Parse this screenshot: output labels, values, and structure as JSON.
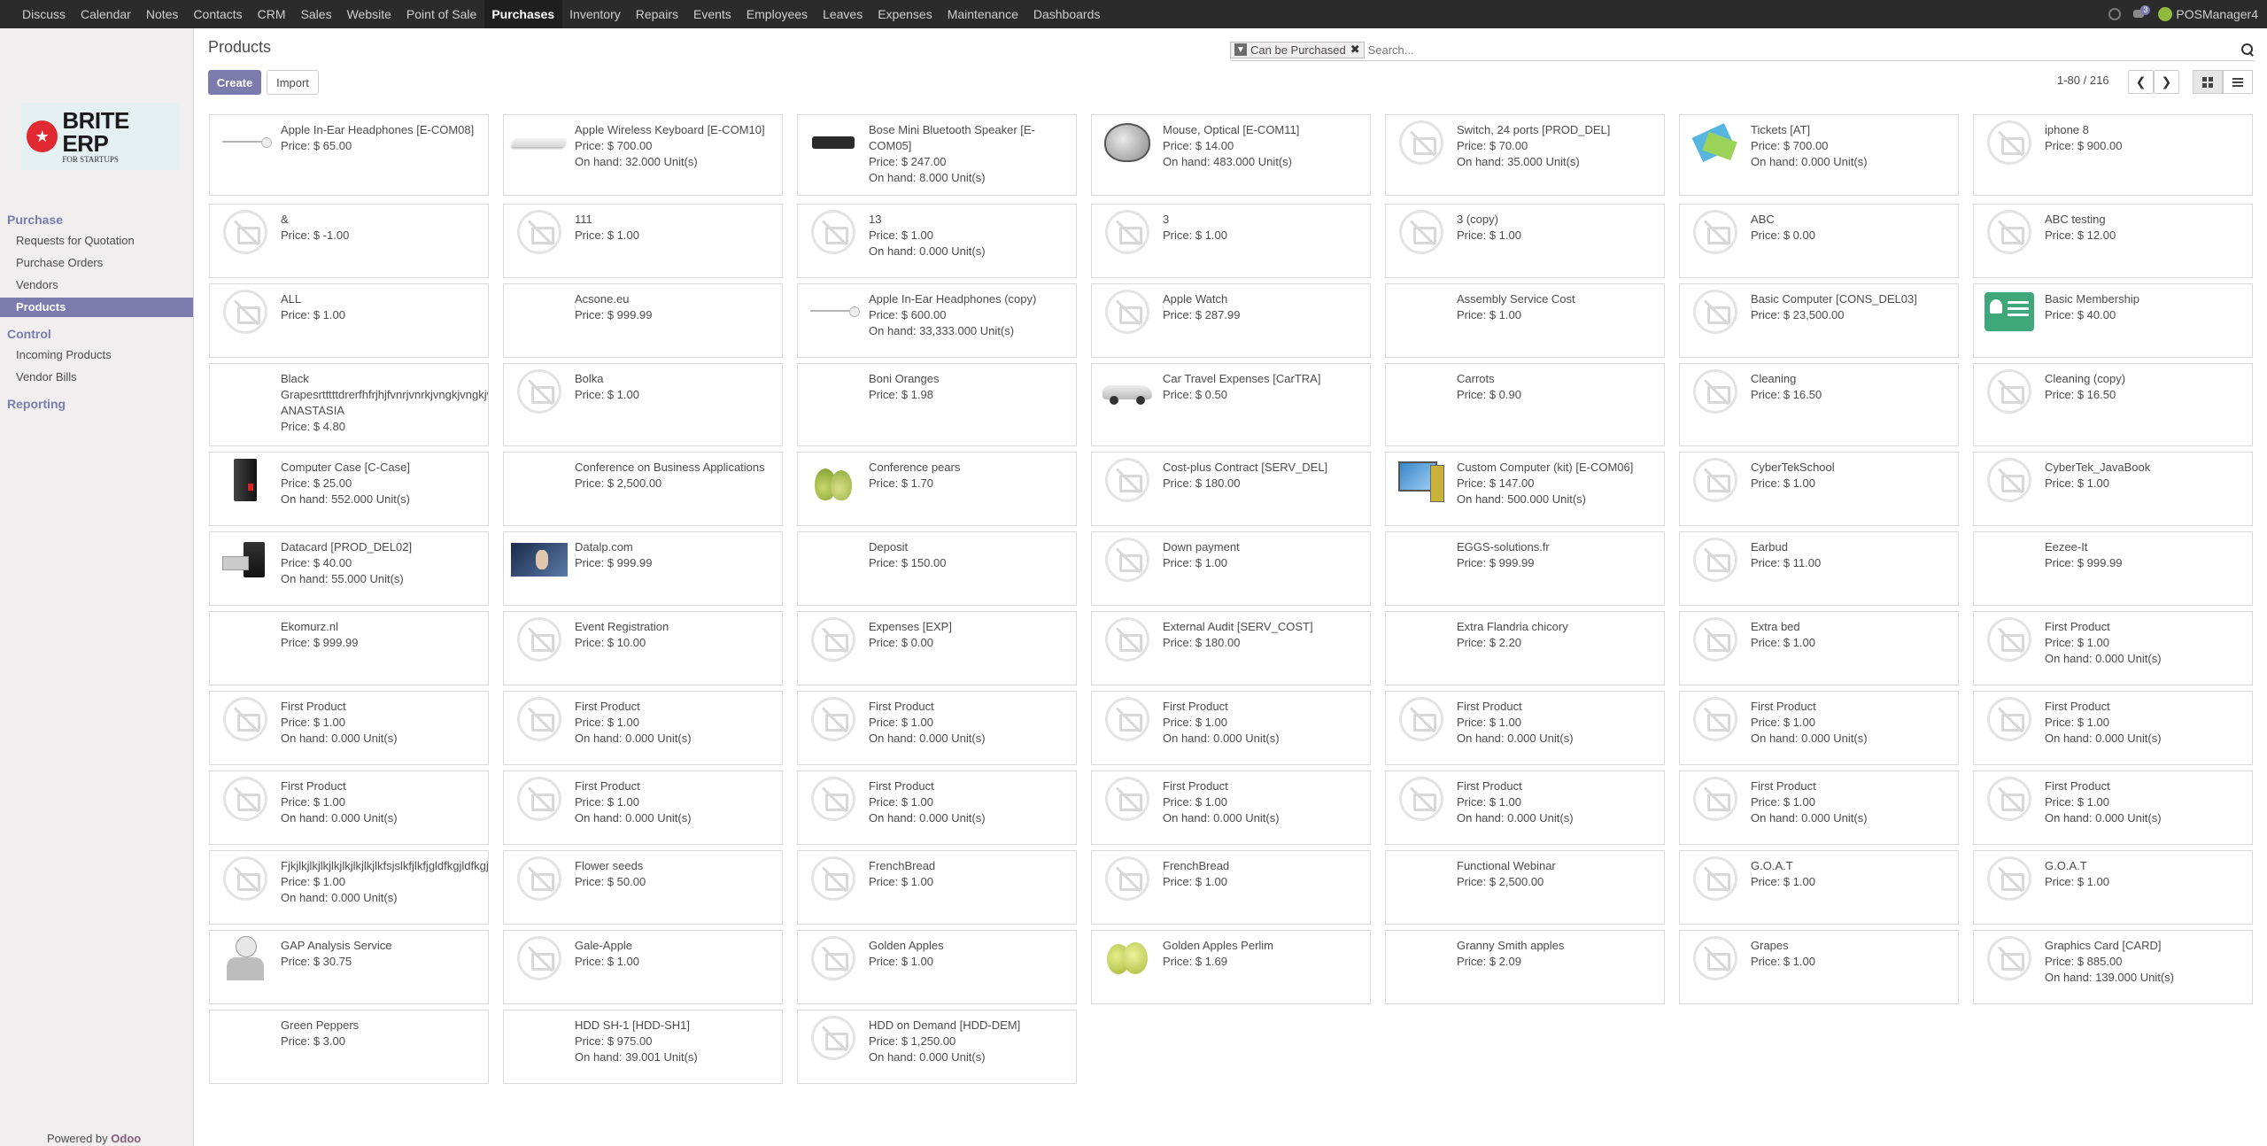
{
  "nav": {
    "apps": [
      "Discuss",
      "Calendar",
      "Notes",
      "Contacts",
      "CRM",
      "Sales",
      "Website",
      "Point of Sale",
      "Purchases",
      "Inventory",
      "Repairs",
      "Events",
      "Employees",
      "Leaves",
      "Expenses",
      "Maintenance",
      "Dashboards"
    ],
    "active": "Purchases",
    "chat_badge": "3",
    "user": "POSManager4"
  },
  "logo": {
    "title": "BRITE ERP",
    "subtitle": "FOR STARTUPS"
  },
  "sidebar": {
    "purchase_header": "Purchase",
    "purchase_items": [
      "Requests for Quotation",
      "Purchase Orders",
      "Vendors",
      "Products"
    ],
    "control_header": "Control",
    "control_items": [
      "Incoming Products",
      "Vendor Bills"
    ],
    "reporting_header": "Reporting",
    "powered_prefix": "Powered by",
    "powered_brand": "Odoo"
  },
  "control_panel": {
    "breadcrumb": "Products",
    "create_label": "Create",
    "import_label": "Import",
    "filter_facet": "Can be Purchased",
    "search_placeholder": "Search...",
    "pager": "1-80 / 216"
  },
  "products": [
    {
      "name": "Apple In-Ear Headphones [E-COM08]",
      "price": "Price: $ 65.00",
      "onhand": "",
      "img": "headphones",
      "wrap": true
    },
    {
      "name": "Apple Wireless Keyboard [E-COM10]",
      "price": "Price: $ 700.00",
      "onhand": "On hand: 32.000 Unit(s)",
      "img": "keyboard"
    },
    {
      "name": "Bose Mini Bluetooth Speaker [E-COM05]",
      "price": "Price: $ 247.00",
      "onhand": "On hand: 8.000 Unit(s)",
      "img": "speaker",
      "wrap": true
    },
    {
      "name": "Mouse, Optical [E-COM11]",
      "price": "Price: $ 14.00",
      "onhand": "On hand: 483.000 Unit(s)",
      "img": "mouse"
    },
    {
      "name": "Switch, 24 ports [PROD_DEL]",
      "price": "Price: $ 70.00",
      "onhand": "On hand: 35.000 Unit(s)",
      "img": "ph"
    },
    {
      "name": "Tickets [AT]",
      "price": "Price: $ 700.00",
      "onhand": "On hand: 0.000 Unit(s)",
      "img": "tickets"
    },
    {
      "name": "iphone 8",
      "price": "Price: $ 900.00",
      "onhand": "",
      "img": "ph"
    },
    {
      "name": "&",
      "price": "Price: $ -1.00",
      "onhand": "",
      "img": "ph"
    },
    {
      "name": "111",
      "price": "Price: $ 1.00",
      "onhand": "",
      "img": "ph"
    },
    {
      "name": "13",
      "price": "Price: $ 1.00",
      "onhand": "On hand: 0.000 Unit(s)",
      "img": "ph"
    },
    {
      "name": "3",
      "price": "Price: $ 1.00",
      "onhand": "",
      "img": "ph"
    },
    {
      "name": "3 (copy)",
      "price": "Price: $ 1.00",
      "onhand": "",
      "img": "ph"
    },
    {
      "name": "ABC",
      "price": "Price: $ 0.00",
      "onhand": "",
      "img": "ph"
    },
    {
      "name": "ABC testing",
      "price": "Price: $ 12.00",
      "onhand": "",
      "img": "ph"
    },
    {
      "name": "ALL",
      "price": "Price: $ 1.00",
      "onhand": "",
      "img": "ph"
    },
    {
      "name": "Acsone.eu",
      "price": "Price: $ 999.99",
      "onhand": "",
      "img": ""
    },
    {
      "name": "Apple In-Ear Headphones (copy)",
      "price": "Price: $ 600.00",
      "onhand": "On hand: 33,333.000 Unit(s)",
      "img": "headphones"
    },
    {
      "name": "Apple Watch",
      "price": "Price: $ 287.99",
      "onhand": "",
      "img": "ph"
    },
    {
      "name": "Assembly Service Cost",
      "price": "Price: $ 1.00",
      "onhand": "",
      "img": ""
    },
    {
      "name": "Basic Computer [CONS_DEL03]",
      "price": "Price: $ 23,500.00",
      "onhand": "",
      "img": "ph"
    },
    {
      "name": "Basic Membership",
      "price": "Price: $ 40.00",
      "onhand": "",
      "img": "member"
    },
    {
      "name": "Black Grapesrtttttdrerfhfrjhjfvnrjvnrkjvngkjvngkjvngkjvngkjvngkjvngkjvngkjvngkjvngkjvngkjvngkjvngkjvngkjvngk ANASTASIA",
      "price": "Price: $ 4.80",
      "onhand": "",
      "img": "",
      "black": true
    },
    {
      "name": "Bolka",
      "price": "Price: $ 1.00",
      "onhand": "",
      "img": "ph"
    },
    {
      "name": "Boni Oranges",
      "price": "Price: $ 1.98",
      "onhand": "",
      "img": ""
    },
    {
      "name": "Car Travel Expenses [CarTRA]",
      "price": "Price: $ 0.50",
      "onhand": "",
      "img": "car"
    },
    {
      "name": "Carrots",
      "price": "Price: $ 0.90",
      "onhand": "",
      "img": ""
    },
    {
      "name": "Cleaning",
      "price": "Price: $ 16.50",
      "onhand": "",
      "img": "ph"
    },
    {
      "name": "Cleaning (copy)",
      "price": "Price: $ 16.50",
      "onhand": "",
      "img": "ph"
    },
    {
      "name": "Computer Case [C-Case]",
      "price": "Price: $ 25.00",
      "onhand": "On hand: 552.000 Unit(s)",
      "img": "case"
    },
    {
      "name": "Conference on Business Applications",
      "price": "Price: $ 2,500.00",
      "onhand": "",
      "img": "",
      "wrap": true
    },
    {
      "name": "Conference pears",
      "price": "Price: $ 1.70",
      "onhand": "",
      "img": "pears"
    },
    {
      "name": "Cost-plus Contract [SERV_DEL]",
      "price": "Price: $ 180.00",
      "onhand": "",
      "img": "ph"
    },
    {
      "name": "Custom Computer (kit) [E-COM06]",
      "price": "Price: $ 147.00",
      "onhand": "On hand: 500.000 Unit(s)",
      "img": "computer"
    },
    {
      "name": "CyberTekSchool",
      "price": "Price: $ 1.00",
      "onhand": "",
      "img": "ph"
    },
    {
      "name": "CyberTek_JavaBook",
      "price": "Price: $ 1.00",
      "onhand": "",
      "img": "ph"
    },
    {
      "name": "Datacard [PROD_DEL02]",
      "price": "Price: $ 40.00",
      "onhand": "On hand: 55.000 Unit(s)",
      "img": "datacard"
    },
    {
      "name": "Datalp.com",
      "price": "Price: $ 999.99",
      "onhand": "",
      "img": "datalp"
    },
    {
      "name": "Deposit",
      "price": "Price: $ 150.00",
      "onhand": "",
      "img": ""
    },
    {
      "name": "Down payment",
      "price": "Price: $ 1.00",
      "onhand": "",
      "img": "ph"
    },
    {
      "name": "EGGS-solutions.fr",
      "price": "Price: $ 999.99",
      "onhand": "",
      "img": ""
    },
    {
      "name": "Earbud",
      "price": "Price: $ 11.00",
      "onhand": "",
      "img": "ph"
    },
    {
      "name": "Eezee-It",
      "price": "Price: $ 999.99",
      "onhand": "",
      "img": ""
    },
    {
      "name": "Ekomurz.nl",
      "price": "Price: $ 999.99",
      "onhand": "",
      "img": ""
    },
    {
      "name": "Event Registration",
      "price": "Price: $ 10.00",
      "onhand": "",
      "img": "ph"
    },
    {
      "name": "Expenses [EXP]",
      "price": "Price: $ 0.00",
      "onhand": "",
      "img": "ph"
    },
    {
      "name": "External Audit [SERV_COST]",
      "price": "Price: $ 180.00",
      "onhand": "",
      "img": "ph"
    },
    {
      "name": "Extra Flandria chicory",
      "price": "Price: $ 2.20",
      "onhand": "",
      "img": ""
    },
    {
      "name": "Extra bed",
      "price": "Price: $ 1.00",
      "onhand": "",
      "img": "ph"
    },
    {
      "name": "First Product",
      "price": "Price: $ 1.00",
      "onhand": "On hand: 0.000 Unit(s)",
      "img": "ph"
    },
    {
      "name": "First Product",
      "price": "Price: $ 1.00",
      "onhand": "On hand: 0.000 Unit(s)",
      "img": "ph"
    },
    {
      "name": "First Product",
      "price": "Price: $ 1.00",
      "onhand": "On hand: 0.000 Unit(s)",
      "img": "ph"
    },
    {
      "name": "First Product",
      "price": "Price: $ 1.00",
      "onhand": "On hand: 0.000 Unit(s)",
      "img": "ph"
    },
    {
      "name": "First Product",
      "price": "Price: $ 1.00",
      "onhand": "On hand: 0.000 Unit(s)",
      "img": "ph"
    },
    {
      "name": "First Product",
      "price": "Price: $ 1.00",
      "onhand": "On hand: 0.000 Unit(s)",
      "img": "ph"
    },
    {
      "name": "First Product",
      "price": "Price: $ 1.00",
      "onhand": "On hand: 0.000 Unit(s)",
      "img": "ph"
    },
    {
      "name": "First Product",
      "price": "Price: $ 1.00",
      "onhand": "On hand: 0.000 Unit(s)",
      "img": "ph"
    },
    {
      "name": "First Product",
      "price": "Price: $ 1.00",
      "onhand": "On hand: 0.000 Unit(s)",
      "img": "ph"
    },
    {
      "name": "First Product",
      "price": "Price: $ 1.00",
      "onhand": "On hand: 0.000 Unit(s)",
      "img": "ph"
    },
    {
      "name": "First Product",
      "price": "Price: $ 1.00",
      "onhand": "On hand: 0.000 Unit(s)",
      "img": "ph"
    },
    {
      "name": "First Product",
      "price": "Price: $ 1.00",
      "onhand": "On hand: 0.000 Unit(s)",
      "img": "ph"
    },
    {
      "name": "First Product",
      "price": "Price: $ 1.00",
      "onhand": "On hand: 0.000 Unit(s)",
      "img": "ph"
    },
    {
      "name": "First Product",
      "price": "Price: $ 1.00",
      "onhand": "On hand: 0.000 Unit(s)",
      "img": "ph"
    },
    {
      "name": "First Product",
      "price": "Price: $ 1.00",
      "onhand": "On hand: 0.000 Unit(s)",
      "img": "ph"
    },
    {
      "name": "Fjkjlkjlkjlkjlkjlkjlkjlkjlkfsjslkfjlkfjgldfkgjldfkgjldfkgjldfkgjldfkgjldfkgjldfkgjldfkgjldfkgjldfkgjldfkgjl",
      "price": "Price: $ 1.00",
      "onhand": "On hand: 0.000 Unit(s)",
      "img": "ph"
    },
    {
      "name": "Flower seeds",
      "price": "Price: $ 50.00",
      "onhand": "",
      "img": "ph"
    },
    {
      "name": "FrenchBread",
      "price": "Price: $ 1.00",
      "onhand": "",
      "img": "ph"
    },
    {
      "name": "FrenchBread",
      "price": "Price: $ 1.00",
      "onhand": "",
      "img": "ph"
    },
    {
      "name": "Functional Webinar",
      "price": "Price: $ 2,500.00",
      "onhand": "",
      "img": ""
    },
    {
      "name": "G.O.A.T",
      "price": "Price: $ 1.00",
      "onhand": "",
      "img": "ph"
    },
    {
      "name": "G.O.A.T",
      "price": "Price: $ 1.00",
      "onhand": "",
      "img": "ph"
    },
    {
      "name": "GAP Analysis Service",
      "price": "Price: $ 30.75",
      "onhand": "",
      "img": "gap"
    },
    {
      "name": "Gale-Apple",
      "price": "Price: $ 1.00",
      "onhand": "",
      "img": "ph"
    },
    {
      "name": "Golden Apples",
      "price": "Price: $ 1.00",
      "onhand": "",
      "img": "ph"
    },
    {
      "name": "Golden Apples Perlim",
      "price": "Price: $ 1.69",
      "onhand": "",
      "img": "apple"
    },
    {
      "name": "Granny Smith apples",
      "price": "Price: $ 2.09",
      "onhand": "",
      "img": ""
    },
    {
      "name": "Grapes",
      "price": "Price: $ 1.00",
      "onhand": "",
      "img": "ph"
    },
    {
      "name": "Graphics Card [CARD]",
      "price": "Price: $ 885.00",
      "onhand": "On hand: 139.000 Unit(s)",
      "img": "ph"
    },
    {
      "name": "Green Peppers",
      "price": "Price: $ 3.00",
      "onhand": "",
      "img": ""
    },
    {
      "name": "HDD SH-1 [HDD-SH1]",
      "price": "Price: $ 975.00",
      "onhand": "On hand: 39.001 Unit(s)",
      "img": ""
    },
    {
      "name": "HDD on Demand [HDD-DEM]",
      "price": "Price: $ 1,250.00",
      "onhand": "On hand: 0.000 Unit(s)",
      "img": "ph"
    }
  ]
}
